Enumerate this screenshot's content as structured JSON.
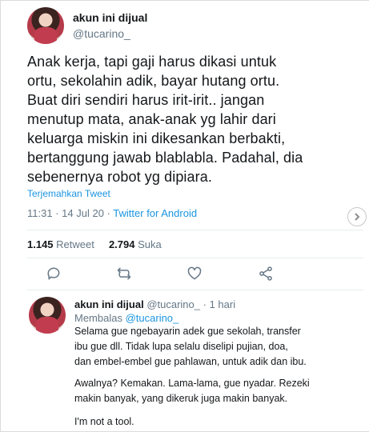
{
  "tweet": {
    "author_name": "akun ini dijual",
    "author_handle": "@tucarino_",
    "text_lines": [
      "Anak kerja, tapi gaji harus dikasi untuk",
      "ortu, sekolahin adik, bayar hutang ortu.",
      "Buat diri sendiri harus irit-irit.. jangan",
      "menutup mata, anak-anak yg lahir dari",
      "keluarga miskin ini dikesankan berbakti,",
      "bertanggung jawab blablabla. Padahal, dia",
      "sebenernya robot yg dipiara."
    ],
    "translate_label": "Terjemahkan Tweet",
    "time": "11:31",
    "date": "14 Jul 20",
    "separator": "·",
    "source": "Twitter for Android",
    "retweet_count": "1.145",
    "retweet_label": "Retweet",
    "like_count": "2.794",
    "like_label": "Suka"
  },
  "actions": {
    "reply_icon": "reply-icon",
    "retweet_icon": "retweet-icon",
    "like_icon": "heart-icon",
    "share_icon": "share-icon"
  },
  "reply": {
    "author_name": "akun ini dijual",
    "author_handle": "@tucarino_",
    "dot": "·",
    "time": "1 hari",
    "replying_prefix": "Membalas",
    "replying_to": "@tucarino_",
    "paragraph1": [
      "Selama gue ngebayarin adek gue sekolah, transfer",
      "ibu gue dll. Tidak lupa selalu diselipi pujian, doa,",
      "dan embel-embel gue pahlawan, untuk adik dan ibu."
    ],
    "paragraph2": [
      "Awalnya? Kemakan. Lama-lama, gue nyadar. Rezeki",
      "makin banyak, yang dikeruk juga makin banyak."
    ],
    "paragraph3": "I'm not a tool."
  },
  "colors": {
    "text": "#14171a",
    "secondary": "#657786",
    "link": "#1b95e0",
    "divider": "#e6ecf0"
  }
}
